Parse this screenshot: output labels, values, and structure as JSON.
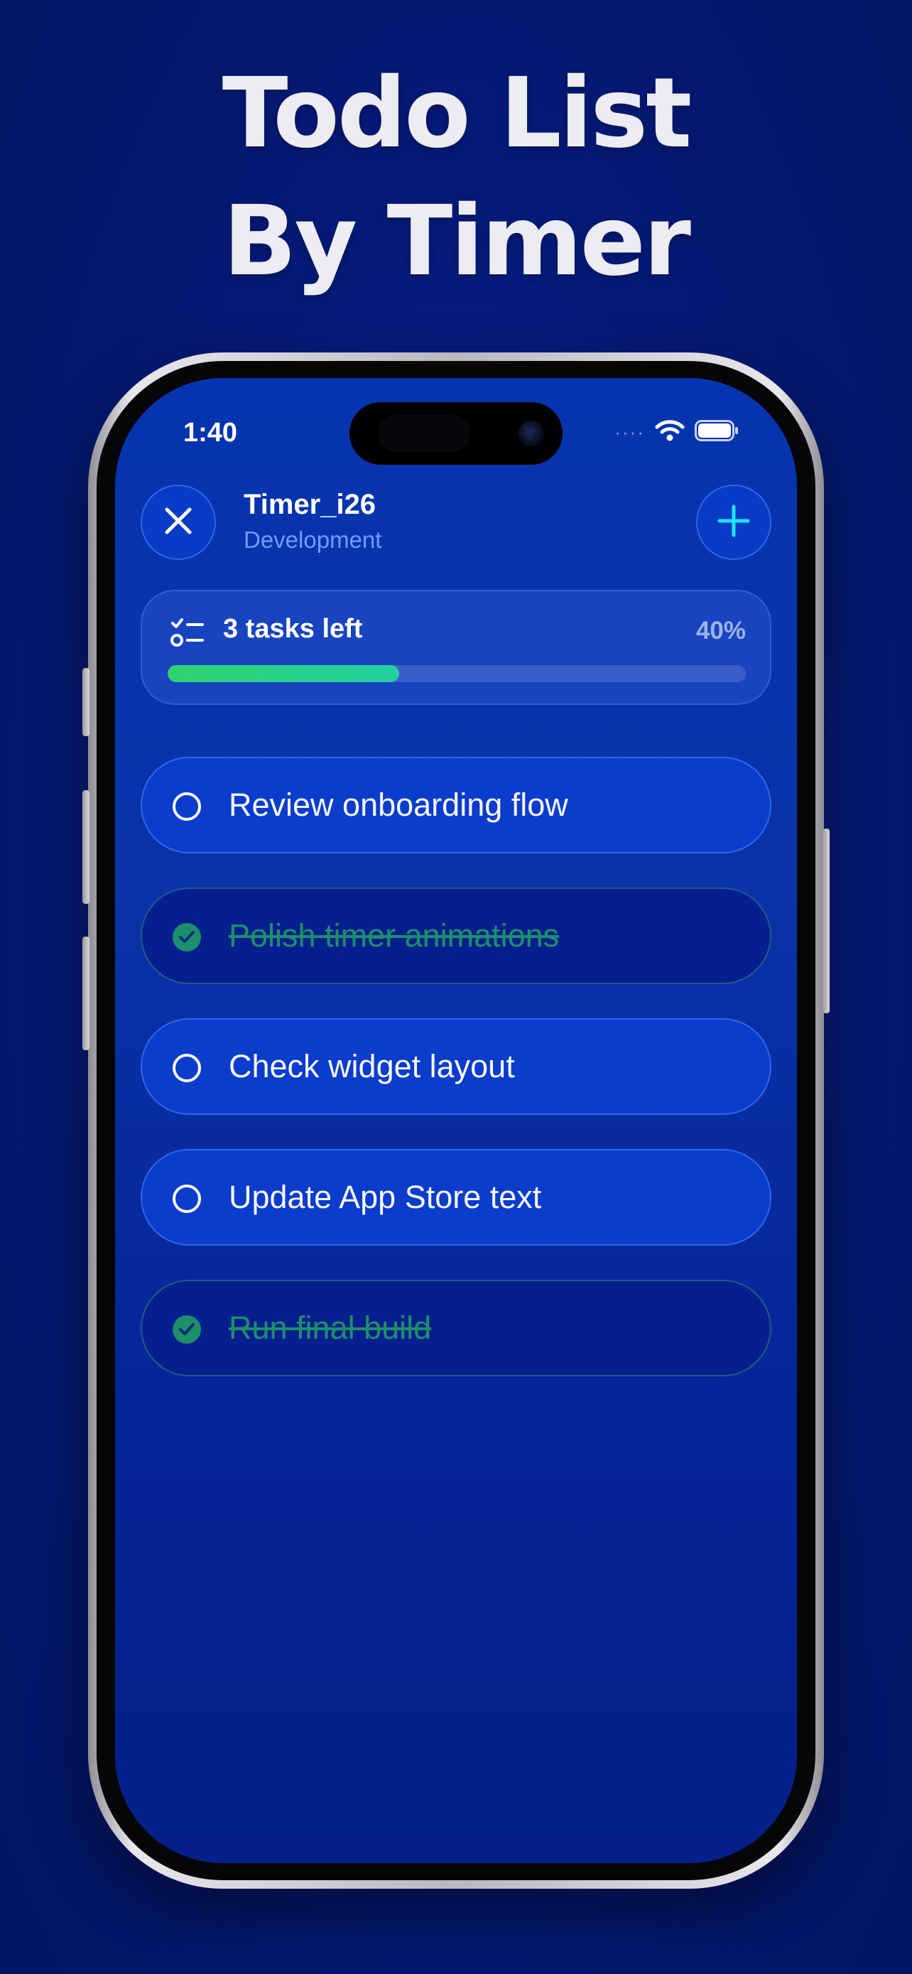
{
  "headline": {
    "line1": "Todo List",
    "line2": "By Timer"
  },
  "status_bar": {
    "time": "1:40"
  },
  "header": {
    "title": "Timer_i26",
    "subtitle": "Development"
  },
  "progress": {
    "label": "3 tasks left",
    "percent_text": "40%",
    "fraction": 0.4
  },
  "tasks": [
    {
      "label": "Review onboarding flow",
      "done": false
    },
    {
      "label": "Polish timer animations",
      "done": true
    },
    {
      "label": "Check widget layout",
      "done": false
    },
    {
      "label": "Update App Store text",
      "done": false
    },
    {
      "label": "Run final build",
      "done": true
    }
  ],
  "colors": {
    "background": "#051a78",
    "accent": "#1fe3ff",
    "done_green": "#1d8f6a",
    "progress_fill": "#2fd36e"
  },
  "icons": {
    "close": "close-icon",
    "add": "plus-icon",
    "tasks": "checklist-icon",
    "open_task": "circle-outline-icon",
    "done_task": "check-circle-icon"
  }
}
